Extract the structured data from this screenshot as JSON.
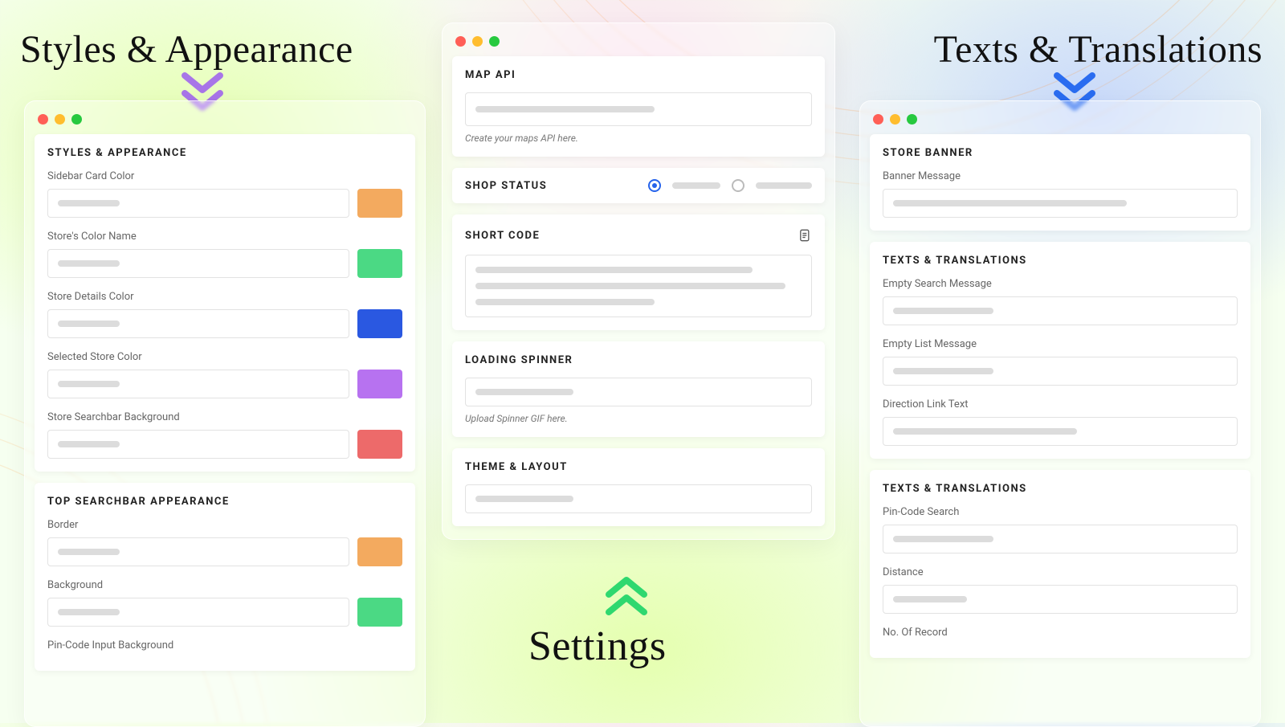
{
  "titles": {
    "styles": "Styles & Appearance",
    "settings": "Settings",
    "texts": "Texts & Translations"
  },
  "colors": {
    "swatch_orange": "#f3aa5f",
    "swatch_green": "#4bd984",
    "swatch_blue": "#2a58e1",
    "swatch_purple": "#b772f0",
    "swatch_red": "#ed6a6a",
    "chev_purple": "#a875e8",
    "chev_blue": "#2a6cf0",
    "chev_green": "#2fd86f"
  },
  "left_window": {
    "cards": [
      {
        "header": "STYLES & APPEARANCE",
        "rows": [
          {
            "label": "Sidebar Card Color",
            "swatch": "swatch_orange"
          },
          {
            "label": "Store's Color Name",
            "swatch": "swatch_green"
          },
          {
            "label": "Store Details Color",
            "swatch": "swatch_blue"
          },
          {
            "label": "Selected Store Color",
            "swatch": "swatch_purple"
          },
          {
            "label": "Store Searchbar Background",
            "swatch": "swatch_red"
          }
        ]
      },
      {
        "header": "TOP SEARCHBAR APPEARANCE",
        "rows": [
          {
            "label": "Border",
            "swatch": "swatch_orange"
          },
          {
            "label": "Background",
            "swatch": "swatch_green"
          },
          {
            "label": "Pin-Code Input Background",
            "swatch": null
          }
        ]
      }
    ]
  },
  "center_window": {
    "cards": {
      "map_api": {
        "header": "MAP API",
        "hint": "Create your maps API here."
      },
      "shop_status": {
        "header": "SHOP STATUS"
      },
      "short_code": {
        "header": "SHORT CODE"
      },
      "loading_spinner": {
        "header": "LOADING SPINNER",
        "hint": "Upload Spinner GIF here."
      },
      "theme_layout": {
        "header": "THEME & LAYOUT"
      }
    }
  },
  "right_window": {
    "cards": [
      {
        "header": "STORE BANNER",
        "rows": [
          {
            "label": "Banner Message"
          }
        ]
      },
      {
        "header": "TEXTS & TRANSLATIONS",
        "rows": [
          {
            "label": "Empty Search Message"
          },
          {
            "label": "Empty List Message"
          },
          {
            "label": "Direction Link Text"
          }
        ]
      },
      {
        "header": "TEXTS & TRANSLATIONS",
        "rows": [
          {
            "label": "Pin-Code Search"
          },
          {
            "label": "Distance"
          },
          {
            "label": "No. Of Record"
          }
        ]
      }
    ]
  }
}
